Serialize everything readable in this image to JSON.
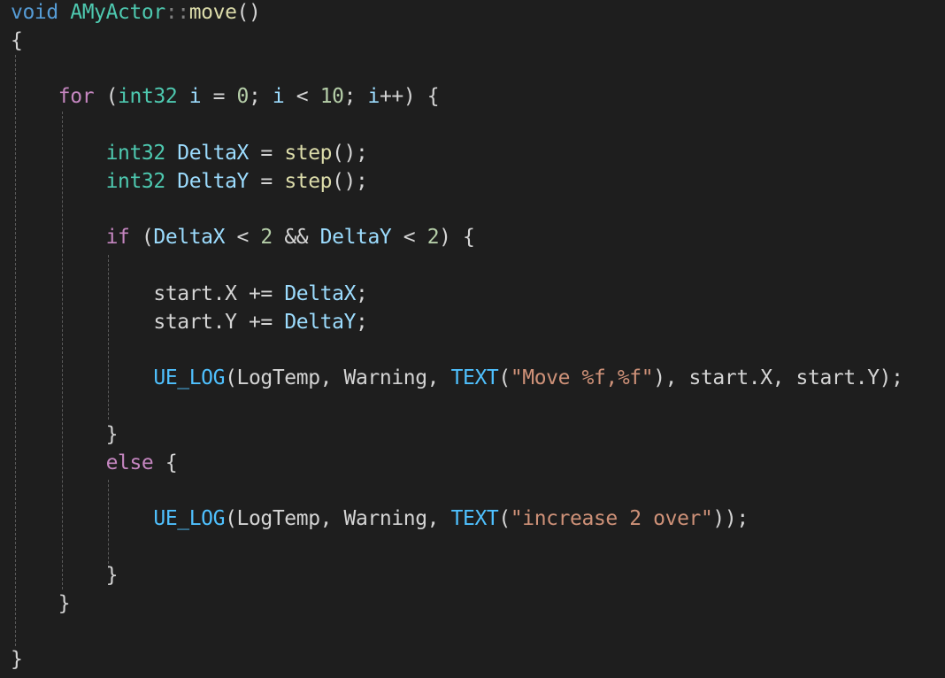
{
  "editor": {
    "language": "cpp",
    "colors": {
      "background": "#1e1e1e",
      "keyword_control": "#c586c0",
      "keyword_storage": "#569cd6",
      "type": "#4ec9b0",
      "function": "#dcdcaa",
      "variable": "#9cdcfe",
      "number": "#b5cea8",
      "string": "#ce9178",
      "macro": "#4fc1ff",
      "text": "#d4d4d4"
    },
    "lines": [
      {
        "tokens": [
          {
            "t": "void",
            "c": "kw-blue"
          },
          {
            "t": " ",
            "c": "punc"
          },
          {
            "t": "AMyActor",
            "c": "cls"
          },
          {
            "t": "::",
            "c": "scope"
          },
          {
            "t": "move",
            "c": "fn"
          },
          {
            "t": "()",
            "c": "punc"
          }
        ]
      },
      {
        "tokens": [
          {
            "t": "{",
            "c": "punc"
          }
        ]
      },
      {
        "tokens": []
      },
      {
        "tokens": [
          {
            "t": "    ",
            "c": "punc"
          },
          {
            "t": "for",
            "c": "kw-purple"
          },
          {
            "t": " (",
            "c": "punc"
          },
          {
            "t": "int32",
            "c": "type"
          },
          {
            "t": " ",
            "c": "punc"
          },
          {
            "t": "i",
            "c": "var"
          },
          {
            "t": " = ",
            "c": "op"
          },
          {
            "t": "0",
            "c": "num"
          },
          {
            "t": "; ",
            "c": "punc"
          },
          {
            "t": "i",
            "c": "var"
          },
          {
            "t": " < ",
            "c": "op"
          },
          {
            "t": "10",
            "c": "num"
          },
          {
            "t": "; ",
            "c": "punc"
          },
          {
            "t": "i",
            "c": "var"
          },
          {
            "t": "++) {",
            "c": "punc"
          }
        ]
      },
      {
        "tokens": []
      },
      {
        "tokens": [
          {
            "t": "        ",
            "c": "punc"
          },
          {
            "t": "int32",
            "c": "type"
          },
          {
            "t": " ",
            "c": "punc"
          },
          {
            "t": "DeltaX",
            "c": "var"
          },
          {
            "t": " = ",
            "c": "op"
          },
          {
            "t": "step",
            "c": "fn"
          },
          {
            "t": "();",
            "c": "punc"
          }
        ]
      },
      {
        "tokens": [
          {
            "t": "        ",
            "c": "punc"
          },
          {
            "t": "int32",
            "c": "type"
          },
          {
            "t": " ",
            "c": "punc"
          },
          {
            "t": "DeltaY",
            "c": "var"
          },
          {
            "t": " = ",
            "c": "op"
          },
          {
            "t": "step",
            "c": "fn"
          },
          {
            "t": "();",
            "c": "punc"
          }
        ]
      },
      {
        "tokens": []
      },
      {
        "tokens": [
          {
            "t": "        ",
            "c": "punc"
          },
          {
            "t": "if",
            "c": "kw-purple"
          },
          {
            "t": " (",
            "c": "punc"
          },
          {
            "t": "DeltaX",
            "c": "var"
          },
          {
            "t": " < ",
            "c": "op"
          },
          {
            "t": "2",
            "c": "num"
          },
          {
            "t": " && ",
            "c": "op"
          },
          {
            "t": "DeltaY",
            "c": "var"
          },
          {
            "t": " < ",
            "c": "op"
          },
          {
            "t": "2",
            "c": "num"
          },
          {
            "t": ") {",
            "c": "punc"
          }
        ]
      },
      {
        "tokens": []
      },
      {
        "tokens": [
          {
            "t": "            ",
            "c": "punc"
          },
          {
            "t": "start",
            "c": "punc"
          },
          {
            "t": ".",
            "c": "punc"
          },
          {
            "t": "X",
            "c": "punc"
          },
          {
            "t": " += ",
            "c": "op"
          },
          {
            "t": "DeltaX",
            "c": "var"
          },
          {
            "t": ";",
            "c": "punc"
          }
        ]
      },
      {
        "tokens": [
          {
            "t": "            ",
            "c": "punc"
          },
          {
            "t": "start",
            "c": "punc"
          },
          {
            "t": ".",
            "c": "punc"
          },
          {
            "t": "Y",
            "c": "punc"
          },
          {
            "t": " += ",
            "c": "op"
          },
          {
            "t": "DeltaY",
            "c": "var"
          },
          {
            "t": ";",
            "c": "punc"
          }
        ]
      },
      {
        "tokens": []
      },
      {
        "tokens": [
          {
            "t": "            ",
            "c": "punc"
          },
          {
            "t": "UE_LOG",
            "c": "macro"
          },
          {
            "t": "(LogTemp, Warning, ",
            "c": "punc"
          },
          {
            "t": "TEXT",
            "c": "macro"
          },
          {
            "t": "(",
            "c": "punc"
          },
          {
            "t": "\"Move %f,%f\"",
            "c": "str"
          },
          {
            "t": "), start.X, start.Y);",
            "c": "punc"
          }
        ]
      },
      {
        "tokens": []
      },
      {
        "tokens": [
          {
            "t": "        }",
            "c": "punc"
          }
        ]
      },
      {
        "tokens": [
          {
            "t": "        ",
            "c": "punc"
          },
          {
            "t": "else",
            "c": "kw-purple"
          },
          {
            "t": " {",
            "c": "punc"
          }
        ]
      },
      {
        "tokens": []
      },
      {
        "tokens": [
          {
            "t": "            ",
            "c": "punc"
          },
          {
            "t": "UE_LOG",
            "c": "macro"
          },
          {
            "t": "(LogTemp, Warning, ",
            "c": "punc"
          },
          {
            "t": "TEXT",
            "c": "macro"
          },
          {
            "t": "(",
            "c": "punc"
          },
          {
            "t": "\"increase 2 over\"",
            "c": "str"
          },
          {
            "t": "));",
            "c": "punc"
          }
        ]
      },
      {
        "tokens": []
      },
      {
        "tokens": [
          {
            "t": "        }",
            "c": "punc"
          }
        ]
      },
      {
        "tokens": [
          {
            "t": "    }",
            "c": "punc"
          }
        ]
      },
      {
        "tokens": []
      },
      {
        "tokens": [
          {
            "t": "}",
            "c": "punc"
          }
        ]
      }
    ]
  }
}
